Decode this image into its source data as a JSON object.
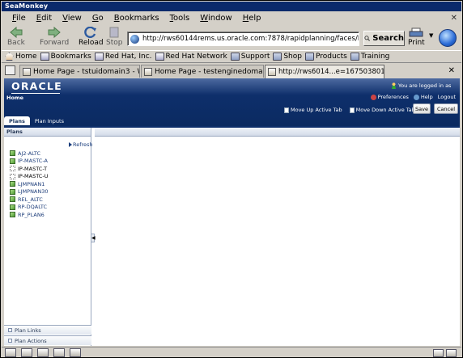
{
  "window": {
    "title": "SeaMonkey"
  },
  "menu": [
    "File",
    "Edit",
    "View",
    "Go",
    "Bookmarks",
    "Tools",
    "Window",
    "Help"
  ],
  "nav": {
    "back": "Back",
    "forward": "Forward",
    "reload": "Reload",
    "stop": "Stop",
    "url": "http://rws60144rems.us.oracle.com:7878/rapidplanning/faces/RPMai",
    "search": "Search",
    "print": "Print"
  },
  "bookmarks": [
    "Home",
    "Bookmarks",
    "Red Hat, Inc.",
    "Red Hat Network",
    "Support",
    "Shop",
    "Products",
    "Training"
  ],
  "browser_tabs": [
    "Home Page - tstuidomain3 - WL...",
    "Home Page - testenginedomain2...",
    "http://rws6014...e=1675038010_3"
  ],
  "app": {
    "brand": "ORACLE",
    "home": "Home",
    "logged_in": "You are logged in as",
    "preferences": "Preferences",
    "help": "Help",
    "logout": "Logout",
    "move_up": "Move Up Active Tab",
    "move_down": "Move Down Active Tab",
    "save": "Save",
    "cancel": "Cancel",
    "tabs": [
      "Plans",
      "Plan Inputs"
    ],
    "panel_title": "Plans",
    "refresh": "Refresh",
    "plans": [
      {
        "name": "AJ2-ALTC",
        "link": true
      },
      {
        "name": "IP-MASTC-A",
        "link": true
      },
      {
        "name": "IP-MASTC-T",
        "link": false
      },
      {
        "name": "IP-MASTC-U",
        "link": false
      },
      {
        "name": "LJMPNAN1",
        "link": true
      },
      {
        "name": "LJMPNAN30",
        "link": true
      },
      {
        "name": "REL_ALTC",
        "link": true
      },
      {
        "name": "RP-DQALTC",
        "link": true
      },
      {
        "name": "RP_PLAN6",
        "link": true
      }
    ],
    "plan_links": "Plan Links",
    "plan_actions": "Plan Actions"
  }
}
